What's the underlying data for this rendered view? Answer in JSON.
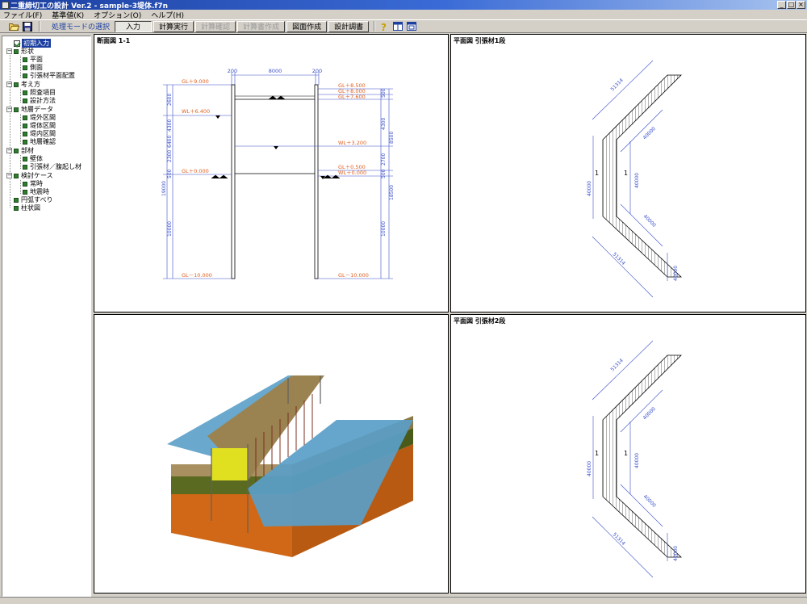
{
  "window": {
    "title": "二重締切工の設計 Ver.2 - sample-3堤体.f7n"
  },
  "menu": [
    "ファイル(F)",
    "基準値(K)",
    "オプション(O)",
    "ヘルプ(H)"
  ],
  "toolbar": {
    "mode_label": "処理モードの選択",
    "buttons": [
      "入力",
      "計算実行",
      "計算確認",
      "計算書作成",
      "図面作成",
      "設計調書"
    ]
  },
  "tree": {
    "root": "初期入力",
    "nodes": [
      "形状",
      "平面",
      "側面",
      "引張材平面配置",
      "考え方",
      "照査項目",
      "設計方法",
      "地層データ",
      "堤外区間",
      "堤体区間",
      "堤内区間",
      "地層確認",
      "部材",
      "壁体",
      "引張材／腹起し材",
      "検討ケース",
      "常時",
      "地震時",
      "円弧すべり",
      "柱状図"
    ]
  },
  "section_view": {
    "title": "断面図 1-1",
    "dims_top": [
      "200",
      "8000",
      "200"
    ],
    "left_labels": [
      "GL＋9.000",
      "WL＋6.400",
      "GL＋0.000",
      "GL－10.000"
    ],
    "right_labels": [
      "GL＋8.500",
      "GL＋8.000",
      "GL＋7.600",
      "WL＋3.200",
      "GL＋0.500",
      "WL＋0.000",
      "GL－10.000"
    ],
    "left_dims": [
      "2600",
      "4300",
      "2300",
      "6400",
      "500",
      "19000",
      "10000"
    ],
    "right_dims": [
      "500",
      "4300",
      "8500",
      "2700",
      "500",
      "10000",
      "18500"
    ]
  },
  "plan1": {
    "title": "平面図 引張材1段",
    "dims": [
      "51314",
      "40000",
      "40000",
      "40000",
      "40000",
      "51314",
      "40000"
    ],
    "marks": [
      "1",
      "1"
    ]
  },
  "plan2": {
    "title": "平面図 引張材2段",
    "dims": [
      "51314",
      "40000",
      "40000",
      "40000",
      "40000",
      "51314",
      "40000"
    ],
    "marks": [
      "1",
      "1"
    ]
  },
  "colors": {
    "accent": "#1c3fa0",
    "dim_blue": "#3a4fc8",
    "level_orange": "#e06020",
    "water": "#5a9ec8",
    "soil_top": "#a89060",
    "soil_mid": "#5a6a20",
    "soil_bottom": "#d06818"
  }
}
